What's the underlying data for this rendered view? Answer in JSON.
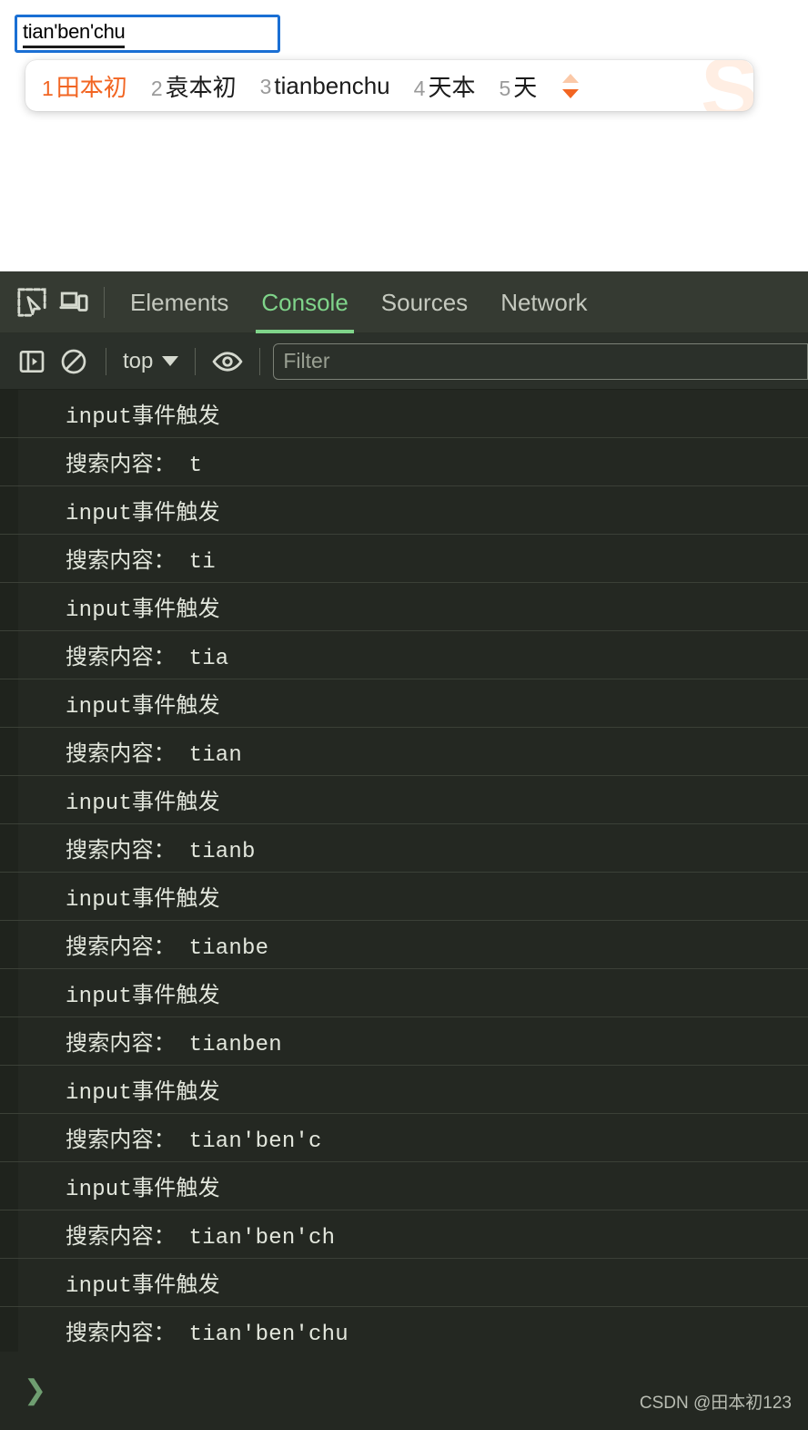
{
  "page": {
    "search_input": {
      "value": "tian'ben'chu",
      "placeholder": ""
    }
  },
  "ime": {
    "candidates": [
      {
        "num": "1",
        "text": "田本初",
        "selected": true
      },
      {
        "num": "2",
        "text": "袁本初",
        "selected": false
      },
      {
        "num": "3",
        "text": "tianbenchu",
        "selected": false
      },
      {
        "num": "4",
        "text": "天本",
        "selected": false
      },
      {
        "num": "5",
        "text": "天",
        "selected": false
      }
    ],
    "watermark": "S",
    "page_up_icon": "chevron-up-icon",
    "page_down_icon": "chevron-down-icon",
    "accent_color": "#f26522"
  },
  "devtools": {
    "toolbar": {
      "inspect_icon": "inspect-element-icon",
      "device_icon": "device-toolbar-icon"
    },
    "tabs": [
      {
        "label": "Elements",
        "active": false
      },
      {
        "label": "Console",
        "active": true
      },
      {
        "label": "Sources",
        "active": false
      },
      {
        "label": "Network",
        "active": false
      }
    ],
    "active_tab_color": "#7fd48a",
    "filterbar": {
      "sidebar_icon": "console-sidebar-icon",
      "clear_icon": "clear-console-icon",
      "context": "top",
      "context_arrow_icon": "chevron-down-icon",
      "eye_icon": "live-expression-eye-icon",
      "filter_placeholder": "Filter",
      "filter_value": ""
    },
    "console_rows": [
      {
        "text": "input事件触发"
      },
      {
        "text": "搜索内容： t"
      },
      {
        "text": "input事件触发"
      },
      {
        "text": "搜索内容： ti"
      },
      {
        "text": "input事件触发"
      },
      {
        "text": "搜索内容： tia"
      },
      {
        "text": "input事件触发"
      },
      {
        "text": "搜索内容： tian"
      },
      {
        "text": "input事件触发"
      },
      {
        "text": "搜索内容： tianb"
      },
      {
        "text": "input事件触发"
      },
      {
        "text": "搜索内容： tianbe"
      },
      {
        "text": "input事件触发"
      },
      {
        "text": "搜索内容： tianben"
      },
      {
        "text": "input事件触发"
      },
      {
        "text": "搜索内容： tian'ben'c"
      },
      {
        "text": "input事件触发"
      },
      {
        "text": "搜索内容： tian'ben'ch"
      },
      {
        "text": "input事件触发"
      },
      {
        "text": "搜索内容： tian'ben'chu"
      }
    ],
    "prompt": {
      "chevron": "❯",
      "value": ""
    }
  },
  "watermark": {
    "text": "CSDN @田本初123"
  }
}
